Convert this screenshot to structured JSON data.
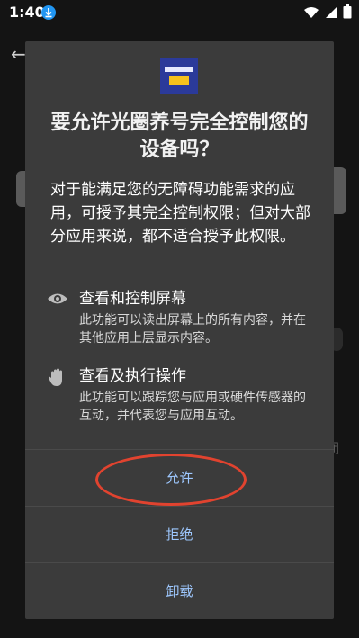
{
  "status_bar": {
    "time": "1:40",
    "icons": [
      "download-icon",
      "wifi-icon",
      "signal-icon",
      "battery-icon"
    ]
  },
  "dialog": {
    "title": "要允许光圈养号完全控制您的设备吗？",
    "description": "对于能满足您的无障碍功能需求的应用，可授予其完全控制权限；但对大部分应用来说，都不适合授予此权限。",
    "capabilities": [
      {
        "icon": "eye-icon",
        "title": "查看和控制屏幕",
        "desc": "此功能可以读出屏幕上的所有内容，并在其他应用上层显示内容。"
      },
      {
        "icon": "hand-icon",
        "title": "查看及执行操作",
        "desc": "此功能可以跟踪您与应用或硬件传感器的互动，并代表您与应用互动。"
      }
    ],
    "buttons": {
      "allow": "允许",
      "deny": "拒绝",
      "uninstall": "卸载"
    }
  },
  "background": {
    "edge_text": "闭"
  },
  "colors": {
    "dialog_bg": "#3b3b3b",
    "button_text": "#9ec8ff",
    "highlight": "#e1432f",
    "app_icon_bg": "#2b3a9a"
  }
}
